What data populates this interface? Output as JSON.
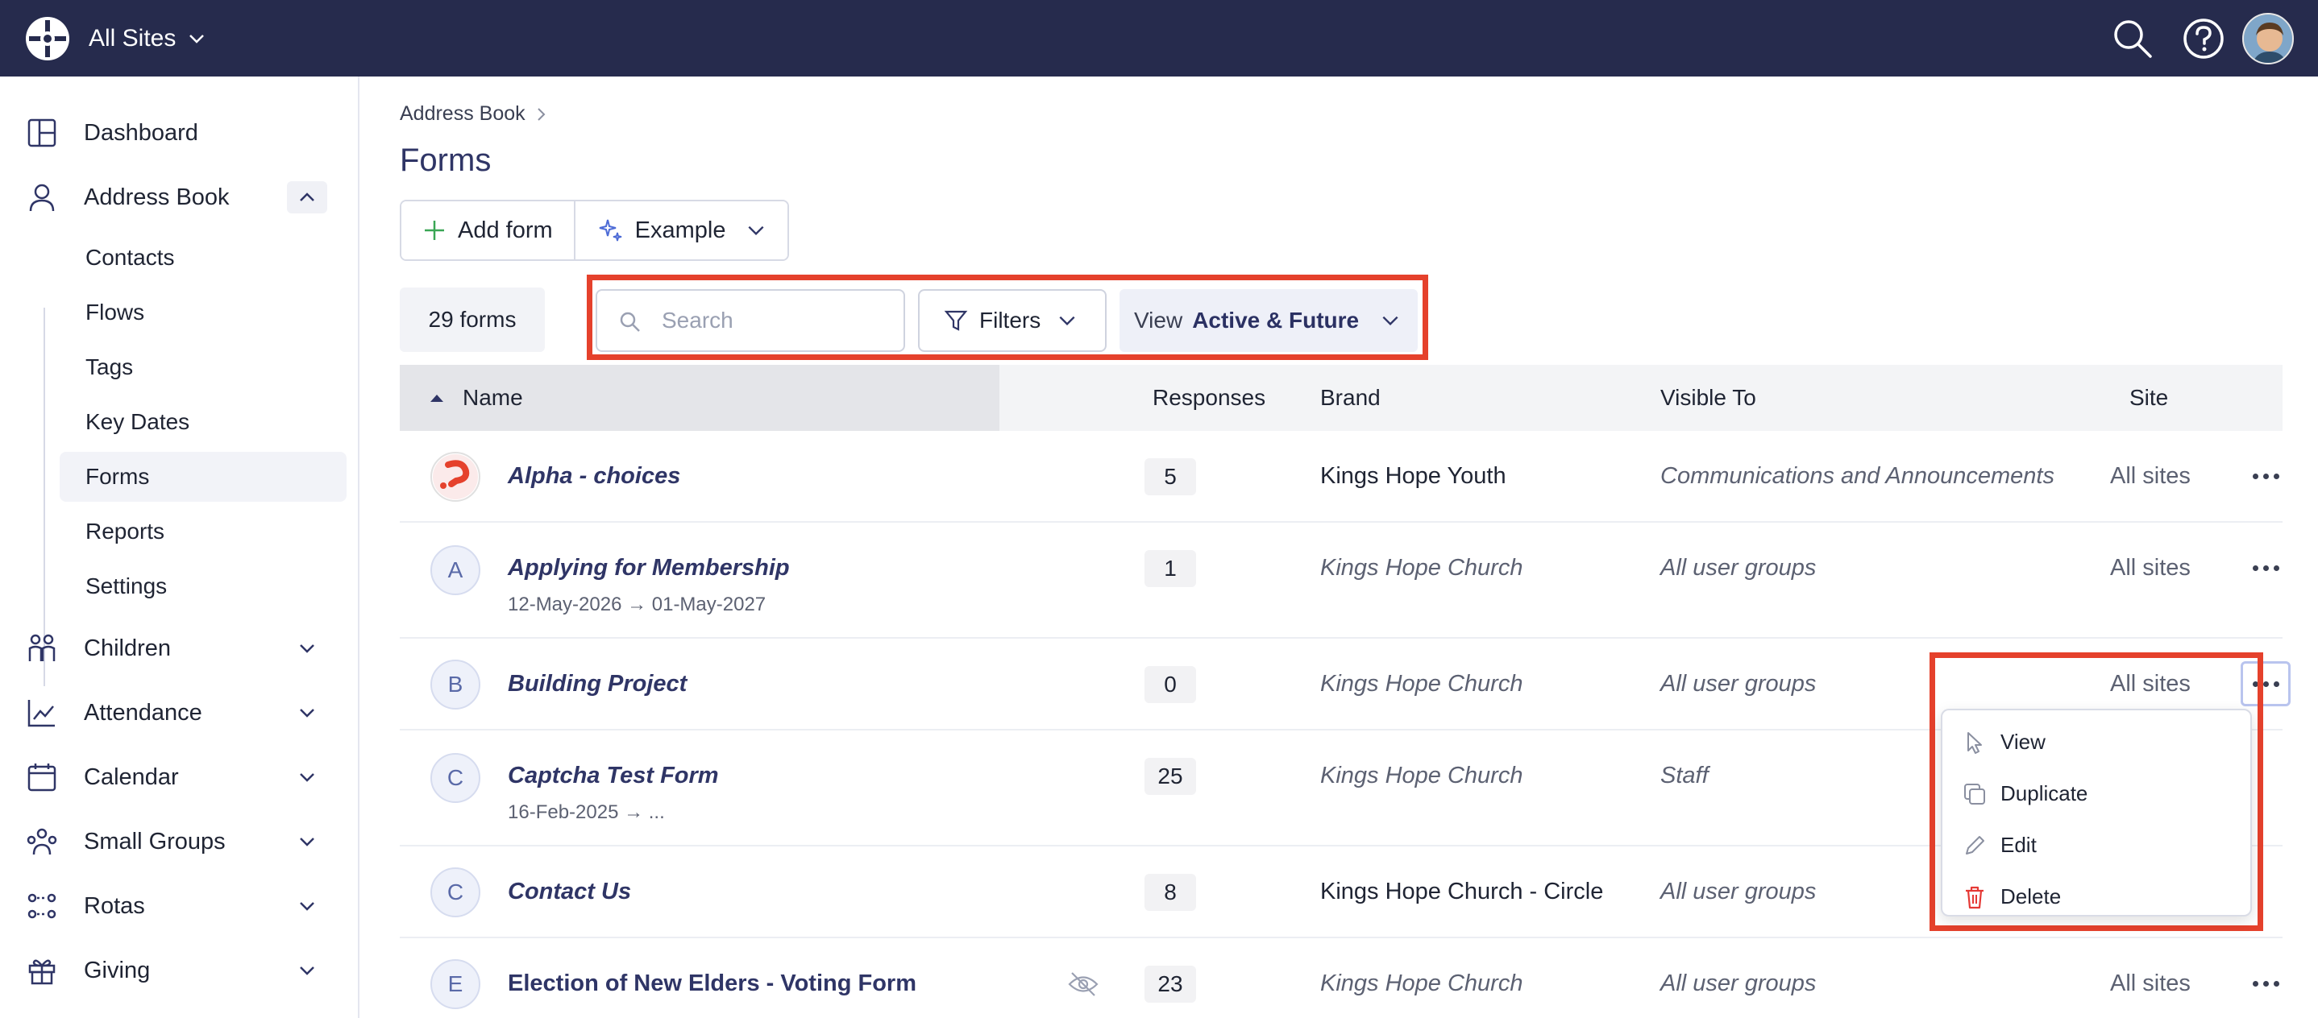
{
  "topbar": {
    "site_label": "All Sites",
    "icons": [
      "logo-icon",
      "search-icon",
      "help-icon",
      "user-avatar"
    ]
  },
  "sidebar": {
    "items": [
      {
        "label": "Dashboard",
        "icon": "dashboard-icon"
      },
      {
        "label": "Address Book",
        "icon": "person-icon",
        "expanded": true
      },
      {
        "label": "Children",
        "icon": "children-icon"
      },
      {
        "label": "Attendance",
        "icon": "attendance-icon"
      },
      {
        "label": "Calendar",
        "icon": "calendar-icon"
      },
      {
        "label": "Small Groups",
        "icon": "small-groups-icon"
      },
      {
        "label": "Rotas",
        "icon": "rotas-icon"
      },
      {
        "label": "Giving",
        "icon": "gift-icon"
      }
    ],
    "sub_items": [
      "Contacts",
      "Flows",
      "Tags",
      "Key Dates",
      "Forms",
      "Reports",
      "Settings"
    ],
    "active_sub": "Forms"
  },
  "main": {
    "breadcrumb": "Address Book",
    "title": "Forms",
    "add_form_label": "Add form",
    "example_label": "Example",
    "count_label": "29 forms",
    "search_placeholder": "Search",
    "filters_label": "Filters",
    "view_prefix": "View",
    "view_value": "Active & Future"
  },
  "table": {
    "headers": {
      "name": "Name",
      "responses": "Responses",
      "brand": "Brand",
      "visible_to": "Visible To",
      "site": "Site"
    },
    "rows": [
      {
        "initial": "",
        "name": "Alpha - choices",
        "dates": "",
        "responses": "5",
        "brand": "Kings Hope Youth",
        "visible_to": "Communications and Announcements",
        "site": "All sites"
      },
      {
        "initial": "A",
        "name": "Applying for Membership",
        "dates": "12-May-2026 → 01-May-2027",
        "responses": "1",
        "brand": "Kings Hope Church",
        "visible_to": "All user groups",
        "site": "All sites"
      },
      {
        "initial": "B",
        "name": "Building Project",
        "dates": "",
        "responses": "0",
        "brand": "Kings Hope Church",
        "visible_to": "All user groups",
        "site": "All sites"
      },
      {
        "initial": "C",
        "name": "Captcha Test Form",
        "dates": "16-Feb-2025 → ...",
        "responses": "25",
        "brand": "Kings Hope Church",
        "visible_to": "Staff",
        "site": ""
      },
      {
        "initial": "C",
        "name": "Contact Us",
        "dates": "",
        "responses": "8",
        "brand": "Kings Hope Church - Circle",
        "visible_to": "All user groups",
        "site": ""
      },
      {
        "initial": "E",
        "name": "Election of New Elders - Voting Form",
        "dates": "",
        "responses": "23",
        "brand": "Kings Hope Church",
        "visible_to": "All user groups",
        "site": "All sites"
      }
    ]
  },
  "context_menu": {
    "items": [
      {
        "label": "View",
        "icon": "cursor-icon"
      },
      {
        "label": "Duplicate",
        "icon": "duplicate-icon"
      },
      {
        "label": "Edit",
        "icon": "pencil-icon"
      },
      {
        "label": "Delete",
        "icon": "trash-icon"
      }
    ]
  },
  "colors": {
    "topbar": "#262b4d",
    "highlight": "#e5412c",
    "link": "#2f3566",
    "delete": "#e53935",
    "add": "#3aa655"
  }
}
